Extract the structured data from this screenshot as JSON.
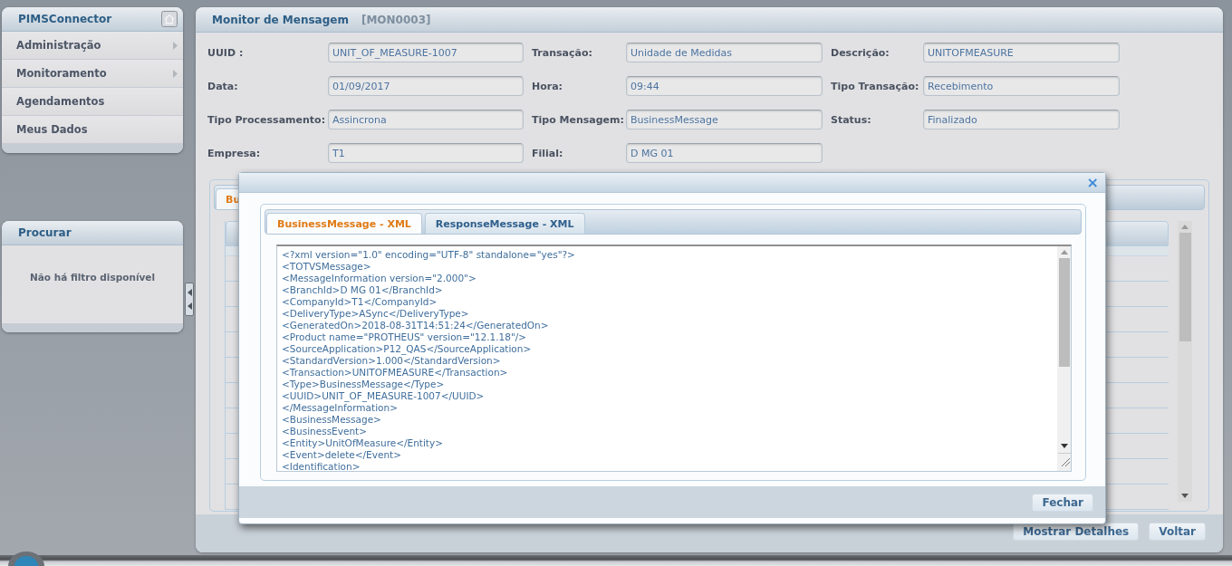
{
  "sidebar": {
    "title": "PIMSConnector",
    "menu": [
      {
        "label": "Administração",
        "submenu": true
      },
      {
        "label": "Monitoramento",
        "submenu": true
      },
      {
        "label": "Agendamentos",
        "submenu": false
      },
      {
        "label": "Meus Dados",
        "submenu": false
      }
    ],
    "search_panel": {
      "title": "Procurar",
      "message": "Não há filtro disponível"
    }
  },
  "main": {
    "title": "Monitor de Mensagem",
    "code": "[MON0003]",
    "fields": [
      {
        "label": "UUID :",
        "value": "UNIT_OF_MEASURE-1007"
      },
      {
        "label": "Transação:",
        "value": "Unidade de Medidas"
      },
      {
        "label": "Descrição:",
        "value": "UNITOFMEASURE"
      },
      {
        "label": "Data:",
        "value": "01/09/2017"
      },
      {
        "label": "Hora:",
        "value": "09:44"
      },
      {
        "label": "Tipo Transação:",
        "value": "Recebimento"
      },
      {
        "label": "Tipo Processamento:",
        "value": "Assincrona"
      },
      {
        "label": "Tipo Mensagem:",
        "value": "BusinessMessage"
      },
      {
        "label": "Status:",
        "value": "Finalizado"
      },
      {
        "label": "Empresa:",
        "value": "T1"
      },
      {
        "label": "Filial:",
        "value": "D MG 01"
      }
    ],
    "background_tab": "Bu",
    "buttons": [
      "Mostrar Detalhes",
      "Voltar"
    ]
  },
  "modal": {
    "tabs": [
      {
        "label": "BusinessMessage - XML",
        "selected": true
      },
      {
        "label": "ResponseMessage - XML",
        "selected": false
      }
    ],
    "close": "×",
    "xml_lines": [
      "<?xml version=\"1.0\" encoding=\"UTF-8\" standalone=\"yes\"?>",
      "<TOTVSMessage>",
      "<MessageInformation version=\"2.000\">",
      "<BranchId>D MG 01</BranchId>",
      "<CompanyId>T1</CompanyId>",
      "<DeliveryType>ASync</DeliveryType>",
      "<GeneratedOn>2018-08-31T14:51:24</GeneratedOn>",
      "<Product name=\"PROTHEUS\" version=\"12.1.18\"/>",
      "<SourceApplication>P12_QAS</SourceApplication>",
      "<StandardVersion>1.000</StandardVersion>",
      "<Transaction>UNITOFMEASURE</Transaction>",
      "<Type>BusinessMessage</Type>",
      "<UUID>UNIT_OF_MEASURE-1007</UUID>",
      "</MessageInformation>",
      "<BusinessMessage>",
      "<BusinessEvent>",
      "<Entity>UnitOfMeasure</Entity>",
      "<Event>delete</Event>",
      "<Identification>"
    ],
    "buttons": [
      "Fechar"
    ]
  }
}
